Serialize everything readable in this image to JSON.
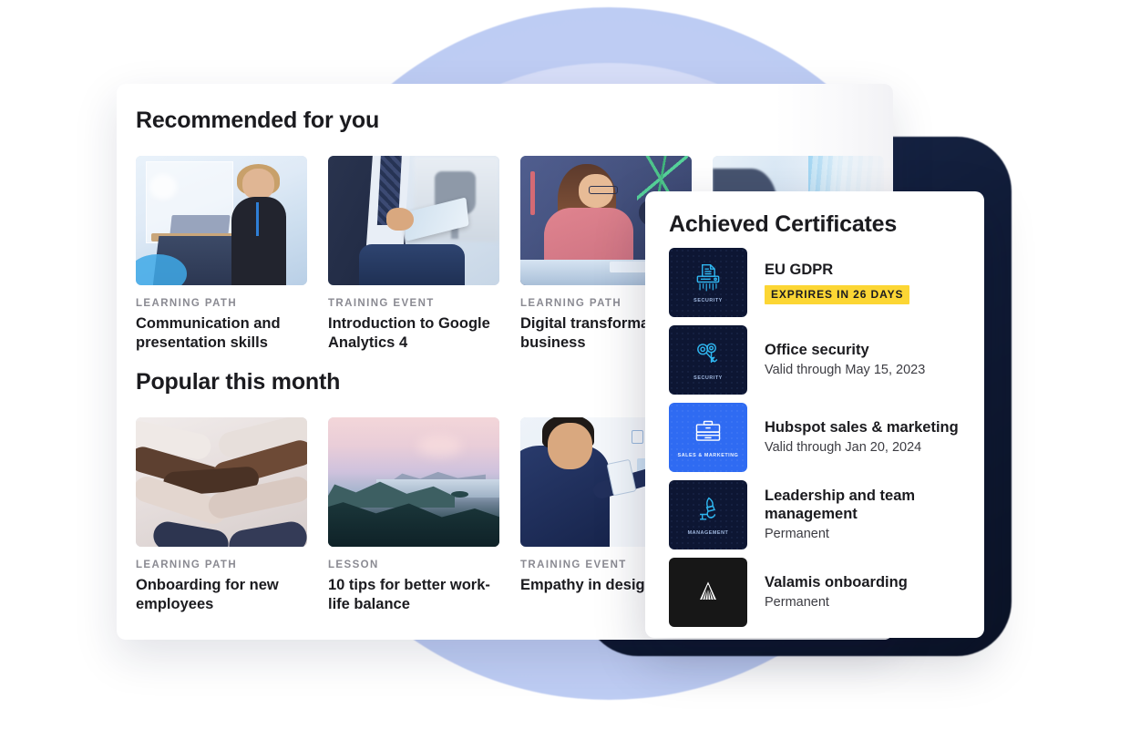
{
  "background": {
    "blob_periwinkle_color": "#c3d0f4",
    "blob_navy_color": "#101b36"
  },
  "main_panel": {
    "sections": [
      {
        "id": "recommended",
        "title": "Recommended for you",
        "cards": [
          {
            "label": "LEARNING PATH",
            "title": "Communication and\npresentation skills",
            "art": "art-podium"
          },
          {
            "label": "TRAINING EVENT",
            "title": "Introduction to Google\nAnalytics 4",
            "art": "art-tablet"
          },
          {
            "label": "LEARNING PATH",
            "title": "Digital transformati\nbusiness",
            "art": "art-desk"
          },
          {
            "label": "",
            "title": "",
            "art": "art-four"
          }
        ]
      },
      {
        "id": "popular",
        "title": "Popular this month",
        "cards": [
          {
            "label": "LEARNING PATH",
            "title": "Onboarding for new\nemployees",
            "art": "art-hands"
          },
          {
            "label": "LESSON",
            "title": "10 tips for better work-\nlife balance",
            "art": "art-lake"
          },
          {
            "label": "TRAINING EVENT",
            "title": "Empathy in design",
            "art": "art-board"
          },
          {
            "label": "",
            "title": "",
            "art": "art-four"
          }
        ]
      }
    ]
  },
  "certificates_panel": {
    "heading": "Achieved Certificates",
    "badge_color": "#fcd634",
    "items": [
      {
        "name": "EU GDPR",
        "category": "SECURITY",
        "tile_style": "navy",
        "icon": "paper-shredder-icon",
        "status": "",
        "badge": "EXPRIRES IN 26 DAYS"
      },
      {
        "name": "Office security",
        "category": "SECURITY",
        "tile_style": "navy",
        "icon": "keys-icon",
        "status": "Valid through May 15, 2023",
        "badge": ""
      },
      {
        "name": "Hubspot sales & marketing",
        "category": "SALES & MARKETING",
        "tile_style": "blue",
        "icon": "briefcase-icon",
        "status": "Valid through Jan 20, 2024",
        "badge": ""
      },
      {
        "name": "Leadership and team\nmanagement",
        "category": "MANAGEMENT",
        "tile_style": "navy",
        "icon": "torch-hand-icon",
        "status": "Permanent",
        "badge": ""
      },
      {
        "name": "Valamis onboarding",
        "category": "",
        "tile_style": "black",
        "icon": "valamis-logo-icon",
        "status": "Permanent",
        "badge": ""
      }
    ]
  }
}
